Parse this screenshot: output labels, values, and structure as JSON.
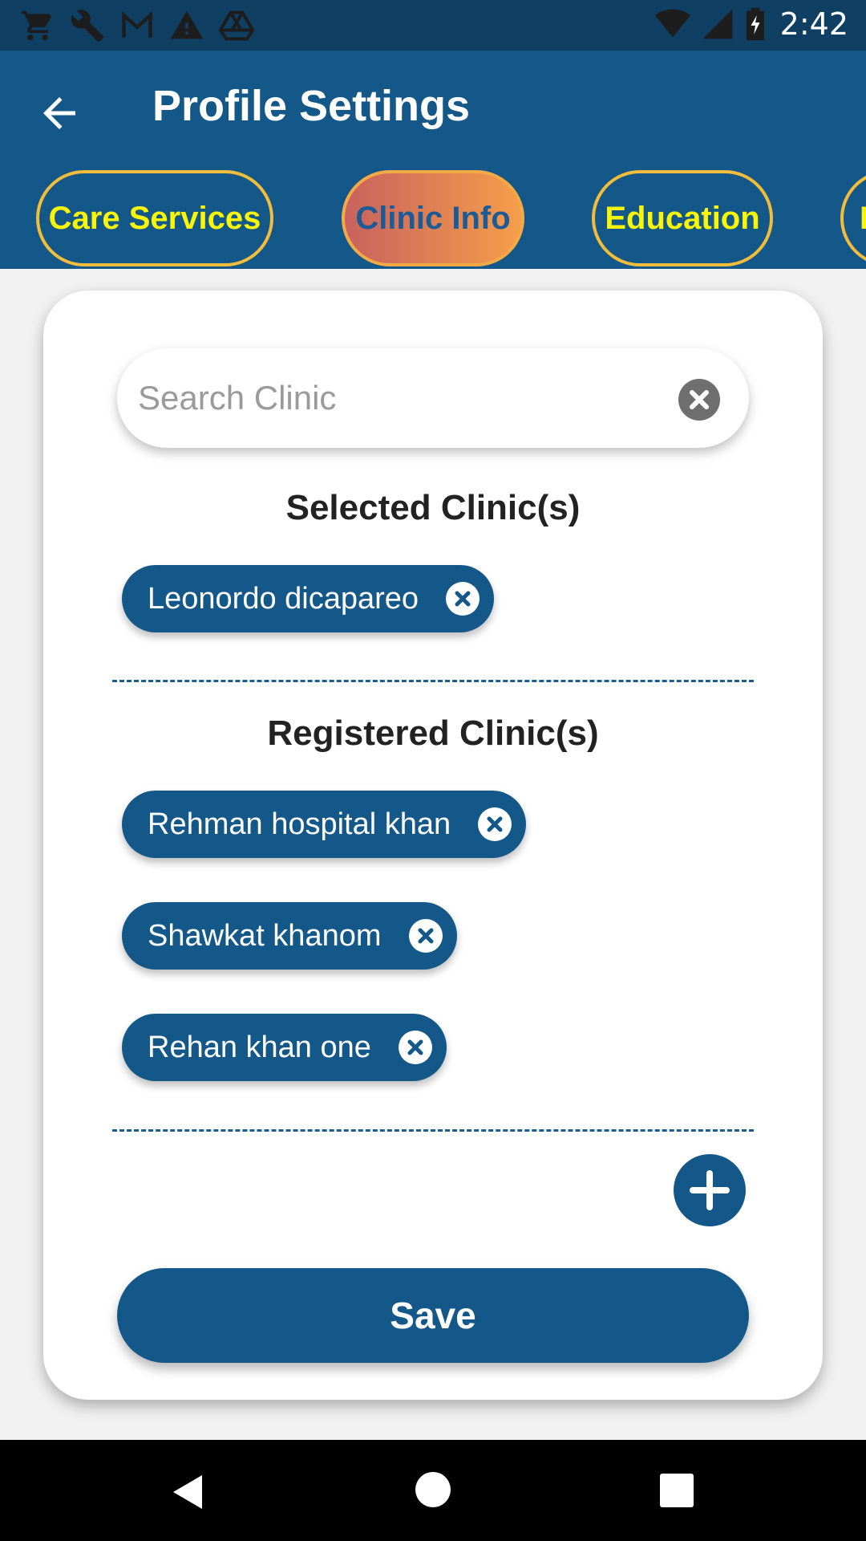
{
  "status_bar": {
    "time": "2:42",
    "left_icons": [
      "cart-icon",
      "wrench-icon",
      "gmail-icon",
      "warning-icon",
      "drive-icon"
    ],
    "right_icons": [
      "wifi-icon",
      "signal-icon",
      "battery-icon"
    ]
  },
  "app_bar": {
    "title": "Profile Settings",
    "back_icon": "arrow-left-icon"
  },
  "tabs": [
    {
      "label": "Care Services",
      "active": false
    },
    {
      "label": "Clinic Info",
      "active": true
    },
    {
      "label": "Education",
      "active": false
    },
    {
      "label": "E",
      "active": false
    }
  ],
  "search": {
    "placeholder": "Search Clinic",
    "value": ""
  },
  "selected": {
    "title": "Selected Clinic(s)",
    "items": [
      "Leonordo dicapareo"
    ]
  },
  "registered": {
    "title": "Registered Clinic(s)",
    "items": [
      "Rehman hospital khan",
      "Shawkat khanom",
      "Rehan khan one"
    ]
  },
  "actions": {
    "save_label": "Save"
  },
  "colors": {
    "primary": "#14588a",
    "status_bar": "#0f3f63",
    "tab_text": "#f9f50a",
    "tab_border": "#f2bd3b",
    "active_tab_gradient_start": "#c8625e",
    "active_tab_gradient_end": "#f59e4a"
  }
}
